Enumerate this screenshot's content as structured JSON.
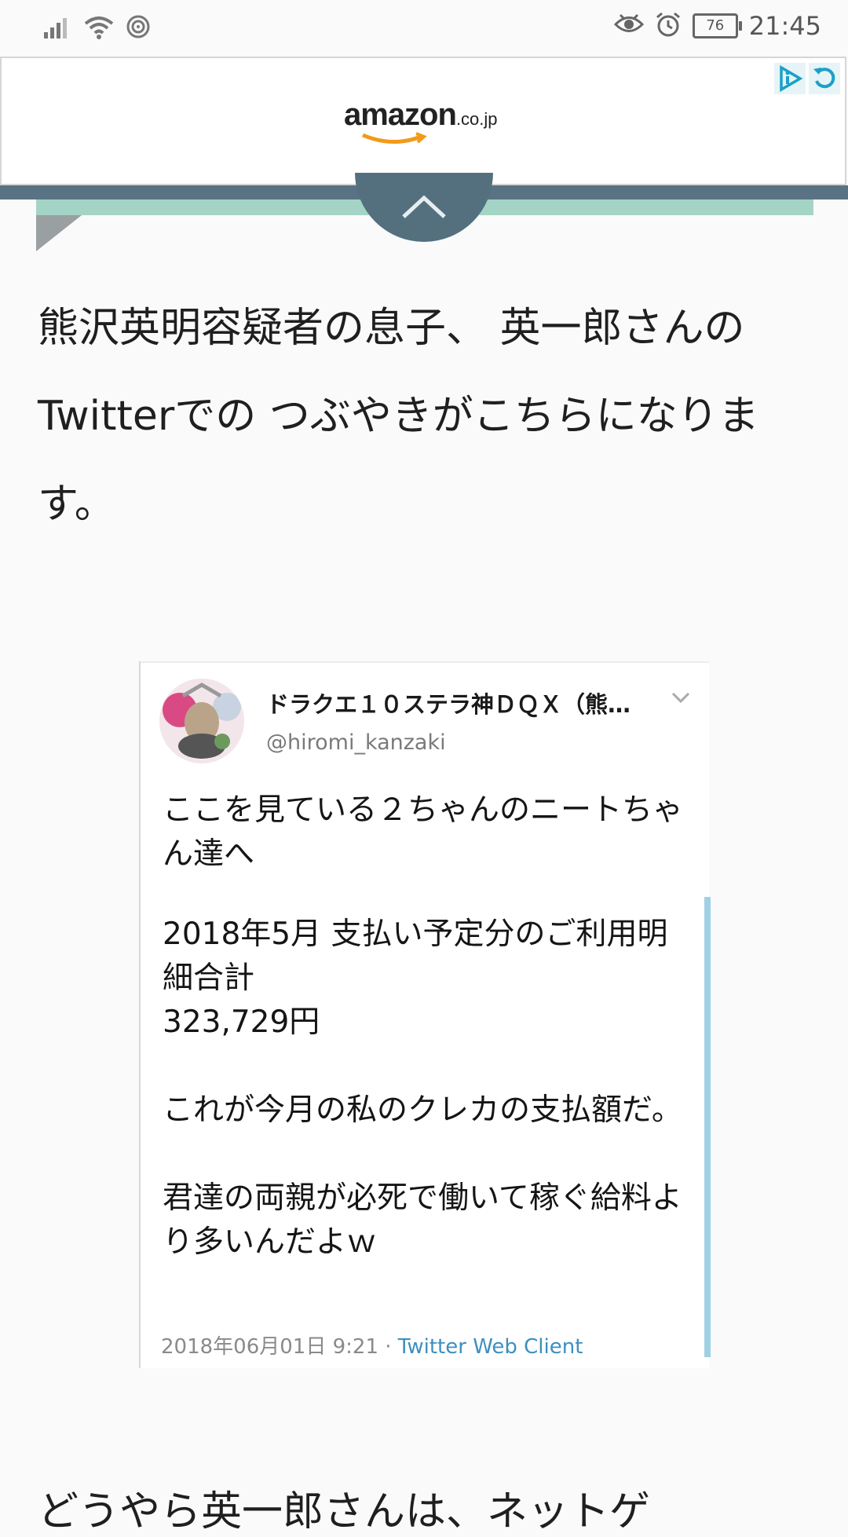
{
  "status_bar": {
    "time": "21:45",
    "battery": "76",
    "icons": [
      "signal-icon",
      "wifi-icon",
      "nfc-icon",
      "eye-icon",
      "alarm-icon",
      "battery-icon"
    ]
  },
  "ad": {
    "logo_word": "amazon",
    "logo_tld": ".co.jp",
    "badges": [
      "adchoices-icon",
      "replay-icon"
    ],
    "accent": "#1aa0c8"
  },
  "article": {
    "lead_text": "熊沢英明容疑者の息子、 英一郎さんのTwitterでの つぶやきがこちらになります。",
    "next_text": "どうやら英一郎さんは、ネットゲ"
  },
  "tweet": {
    "display_name": "ドラクエ１０ステラ神ＤＱＸ（熊…",
    "handle": "@hiromi_kanzaki",
    "paragraphs": [
      "ここを見ている２ちゃんのニートちゃん達へ",
      "2018年5月 支払い予定分のご利用明細合計\n323,729円",
      "これが今月の私のクレカの支払額だ。",
      "君達の両親が必死で働いて稼ぐ給料より多いんだよｗ"
    ],
    "timestamp": "2018年06月01日 9:21",
    "separator": " · ",
    "client": "Twitter Web Client"
  },
  "colors": {
    "header_dark": "#5a7384",
    "header_green": "#a4d4c5",
    "tweet_bar": "#9fd1e4",
    "link": "#3d8fbf"
  }
}
